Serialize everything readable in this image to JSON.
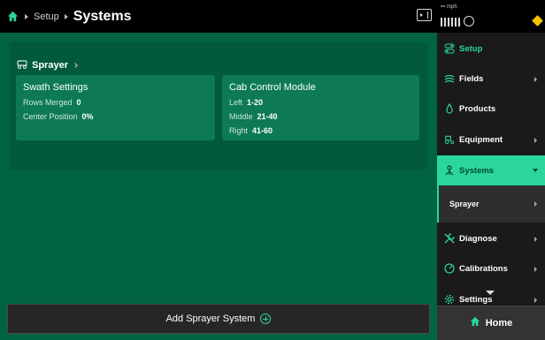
{
  "header": {
    "breadcrumb": "Setup",
    "title": "Systems"
  },
  "status": {
    "speed_value": "--",
    "speed_unit": "mph"
  },
  "card": {
    "name": "Sprayer",
    "swath": {
      "title": "Swath Settings",
      "rows_label": "Rows Merged",
      "rows_value": "0",
      "center_label": "Center Position",
      "center_value": "0%"
    },
    "cab": {
      "title": "Cab Control Module",
      "left_label": "Left",
      "left_value": "1-20",
      "middle_label": "Middle",
      "middle_value": "21-40",
      "right_label": "Right",
      "right_value": "41-60"
    }
  },
  "add_button": "Add Sprayer System",
  "sidebar": {
    "setup": "Setup",
    "fields": "Fields",
    "products": "Products",
    "equipment": "Equipment",
    "systems": "Systems",
    "sprayer": "Sprayer",
    "diagnose": "Diagnose",
    "calibrations": "Calibrations",
    "settings": "Settings",
    "home": "Home"
  },
  "colors": {
    "accent": "#2bd69b",
    "main_bg": "#006443",
    "card_bg": "#005a3b",
    "sub_bg": "#0d7a55",
    "warning": "#f2c200"
  }
}
